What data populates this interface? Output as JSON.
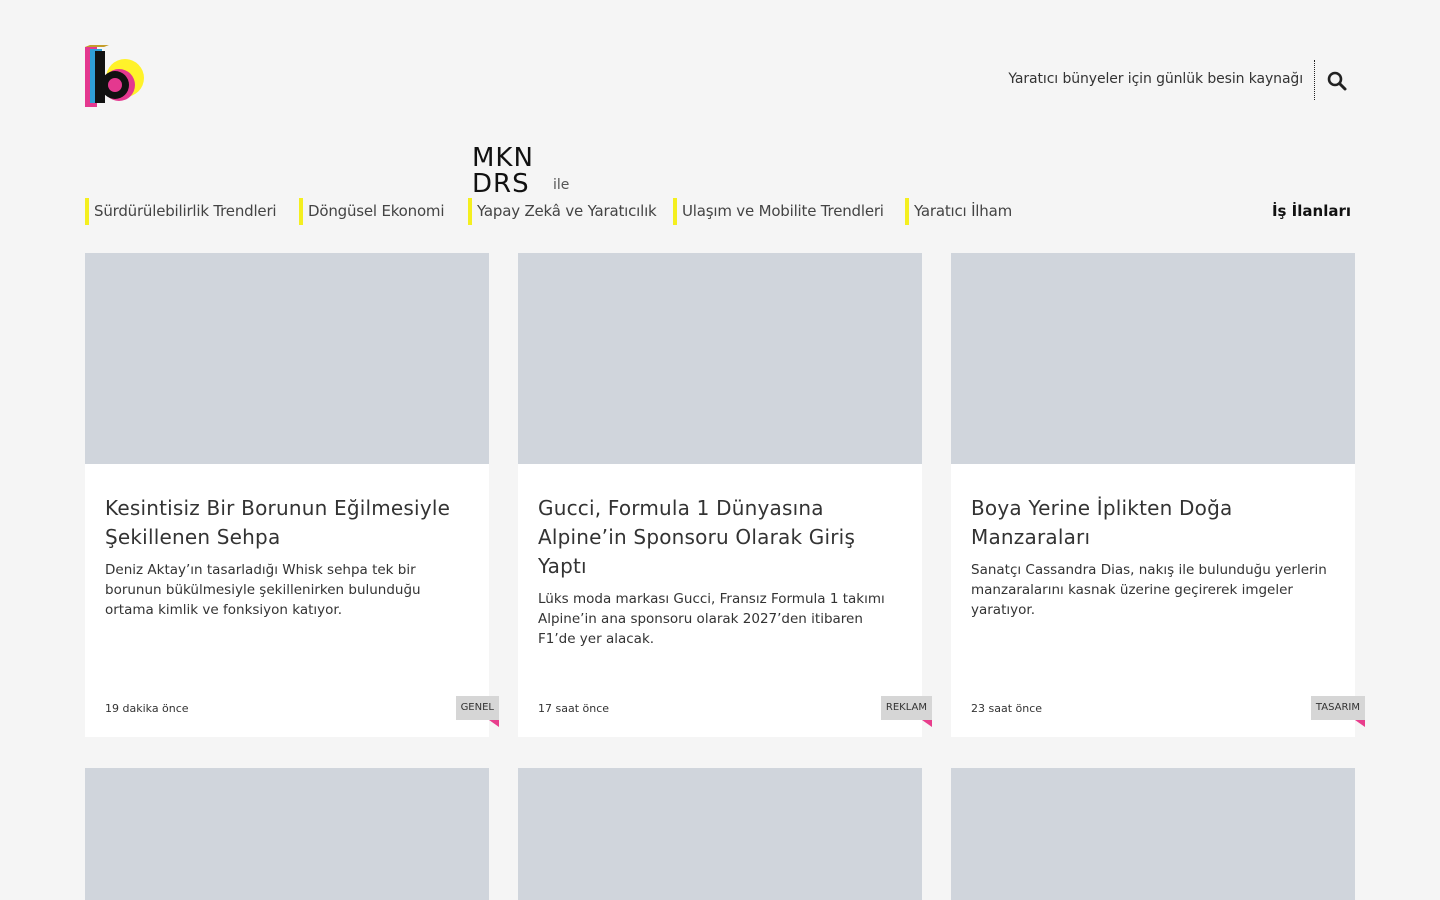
{
  "header": {
    "tagline": "Yaratıcı bünyeler için günlük besin kaynağı",
    "logo_icon": "logo-b-icon",
    "search_icon": "search-icon"
  },
  "sponsor": {
    "logo_text_line1": "MKN",
    "logo_text_line2": "DRS",
    "suffix": "ile"
  },
  "nav": {
    "items": [
      {
        "label": "Sürdürülebilirlik Trendleri"
      },
      {
        "label": "Döngüsel Ekonomi"
      },
      {
        "label": "Yapay Zekâ ve Yaratıcılık"
      },
      {
        "label": "Ulaşım ve Mobilite Trendleri"
      },
      {
        "label": "Yaratıcı İlham"
      }
    ],
    "jobs_label": "İş İlanları",
    "accent_color": "#f4ef1f"
  },
  "cards": [
    {
      "title": "Kesintisiz Bir Borunun Eğilmesiyle Şekillenen Sehpa",
      "excerpt": "Deniz Aktay’ın tasarladığı Whisk sehpa tek bir borunun bükülmesiyle şekillenirken bulunduğu ortama kimlik ve fonksiyon katıyor.",
      "time": "19 dakika önce",
      "tag": "GENEL"
    },
    {
      "title": "Gucci, Formula 1 Dünyasına Alpine’in Sponsoru Olarak Giriş Yaptı",
      "excerpt": "Lüks moda markası Gucci, Fransız Formula 1 takımı Alpine’in ana sponsoru olarak 2027’den itibaren F1’de yer alacak.",
      "time": "17 saat önce",
      "tag": "REKLAM"
    },
    {
      "title": "Boya Yerine İplikten Doğa Manzaraları",
      "excerpt": "Sanatçı Cassandra Dias, nakış ile bulunduğu yerlerin manzaralarını kasnak üzerine geçirerek imgeler yaratıyor.",
      "time": "23 saat önce",
      "tag": "TASARIM"
    }
  ],
  "colors": {
    "tag_corner": "#e83e8c",
    "image_placeholder": "#d0d5dc",
    "background": "#f5f5f5"
  }
}
